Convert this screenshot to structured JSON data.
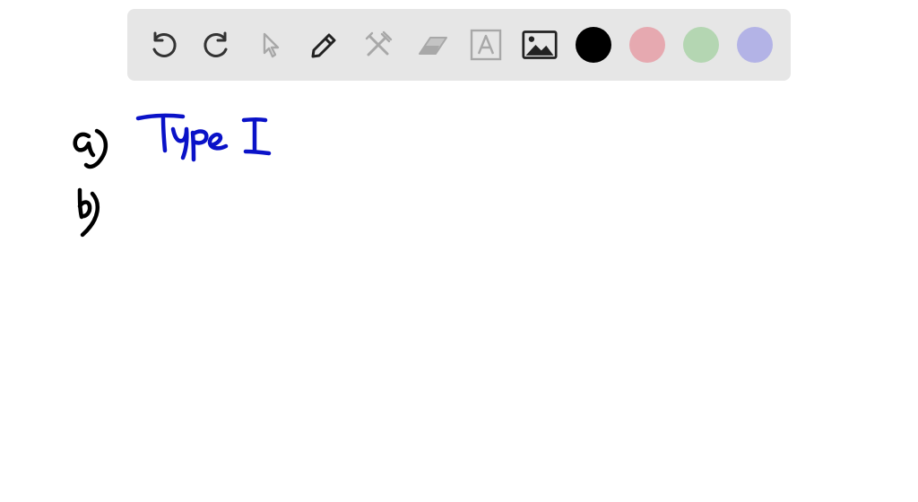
{
  "toolbar": {
    "tools": [
      {
        "name": "undo-button",
        "icon": "undo-icon",
        "state": "enabled"
      },
      {
        "name": "redo-button",
        "icon": "redo-icon",
        "state": "enabled"
      },
      {
        "name": "select-button",
        "icon": "cursor-icon",
        "state": "disabled"
      },
      {
        "name": "pen-button",
        "icon": "pencil-icon",
        "state": "enabled"
      },
      {
        "name": "tools-button",
        "icon": "tools-icon",
        "state": "disabled"
      },
      {
        "name": "eraser-button",
        "icon": "eraser-icon",
        "state": "disabled"
      },
      {
        "name": "text-button",
        "icon": "text-icon",
        "state": "disabled"
      },
      {
        "name": "image-button",
        "icon": "image-icon",
        "state": "enabled"
      }
    ],
    "colors": [
      {
        "name": "black",
        "hex": "#000000",
        "selected": true
      },
      {
        "name": "pink",
        "hex": "#e6a9b0"
      },
      {
        "name": "green",
        "hex": "#b4d6b2"
      },
      {
        "name": "lavender",
        "hex": "#b3b3e6"
      }
    ]
  },
  "canvas": {
    "ink_colors": {
      "black": "#000000",
      "blue": "#0a12c8"
    },
    "handwriting": [
      {
        "label": "a)",
        "text": "Type I",
        "color": "blue"
      },
      {
        "label": "b)",
        "text": "",
        "color": "black"
      }
    ]
  }
}
